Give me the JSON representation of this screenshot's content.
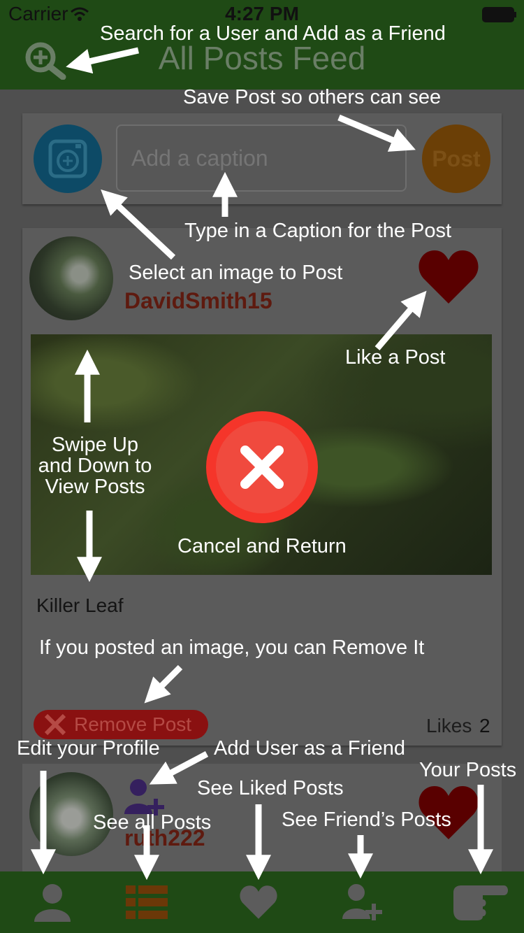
{
  "status": {
    "carrier": "Carrier",
    "time": "4:27 PM"
  },
  "nav": {
    "title": "All Posts Feed",
    "search_icon": "search-plus-icon"
  },
  "composer": {
    "caption_placeholder": "Add a caption",
    "post_label": "Post"
  },
  "post": {
    "username": "DavidSmith15",
    "caption": "Killer Leaf",
    "remove_label": "Remove Post",
    "likes_label": "Likes",
    "likes_count": "2"
  },
  "post2": {
    "username": "ruth222"
  },
  "tabs": [
    {
      "icon": "profile-icon"
    },
    {
      "icon": "list-icon"
    },
    {
      "icon": "heart-icon"
    },
    {
      "icon": "add-friend-icon"
    },
    {
      "icon": "pointing-hand-icon"
    }
  ],
  "annotations": {
    "search": "Search for a User and Add as a Friend",
    "save_post": "Save Post so others can see",
    "type_caption": "Type in a Caption for the Post",
    "select_image": "Select an image to Post",
    "like_post": "Like a Post",
    "swipe_line1": "Swipe Up",
    "swipe_line2": "and Down to",
    "swipe_line3": "View Posts",
    "cancel": "Cancel and Return",
    "remove_hint": "If you posted an image, you can Remove It",
    "edit_profile": "Edit your Profile",
    "add_friend": "Add User as a Friend",
    "liked_posts": "See Liked Posts",
    "your_posts": "Your Posts",
    "all_posts": "See all Posts",
    "friends_posts": "See Friend’s Posts"
  },
  "colors": {
    "nav_green": "#1f4a15",
    "accent_red": "#f5352a",
    "post_orange": "#6b3f06"
  }
}
